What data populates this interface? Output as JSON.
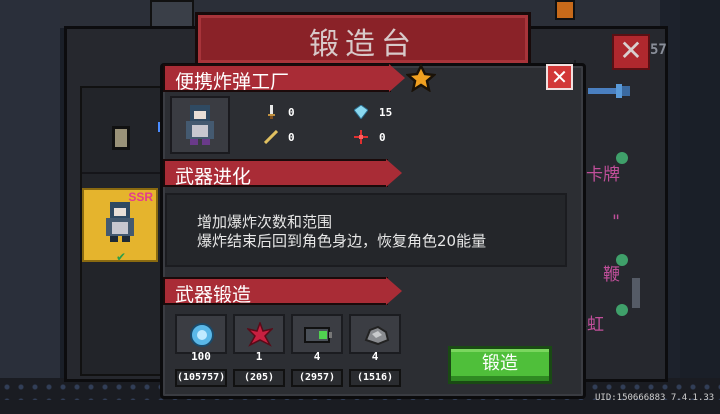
{
  "back_window": {
    "title": "锻造台",
    "count": "57",
    "list_items": [
      "卡牌",
      "\"",
      "鞭",
      "彩虹马"
    ]
  },
  "left_column": {
    "selected_card_rarity": "SSR"
  },
  "weapon": {
    "name": "便携炸弹工厂",
    "stats": {
      "attack": "0",
      "energy": "15",
      "critical": "0",
      "accuracy": "0"
    }
  },
  "sections": {
    "evolution": "武器进化",
    "forge": "武器锻造"
  },
  "evolution_desc": [
    "增加爆炸次数和范围",
    "爆炸结束后回到角色身边，恢复角色20能量"
  ],
  "materials": [
    {
      "icon": "blue-gem-icon",
      "need": "100",
      "have": "(105757)"
    },
    {
      "icon": "red-leaf-icon",
      "need": "1",
      "have": "(205)"
    },
    {
      "icon": "green-battery-icon",
      "need": "4",
      "have": "(2957)"
    },
    {
      "icon": "ore-icon",
      "need": "4",
      "have": "(1516)"
    }
  ],
  "forge_button": "锻造",
  "footer": {
    "uid": "UID:150666883 7.4.1.33"
  },
  "colors": {
    "ribbon": "#a92c36",
    "forge_button": "#4fbf3a",
    "ssr_card": "#e5b42d"
  }
}
